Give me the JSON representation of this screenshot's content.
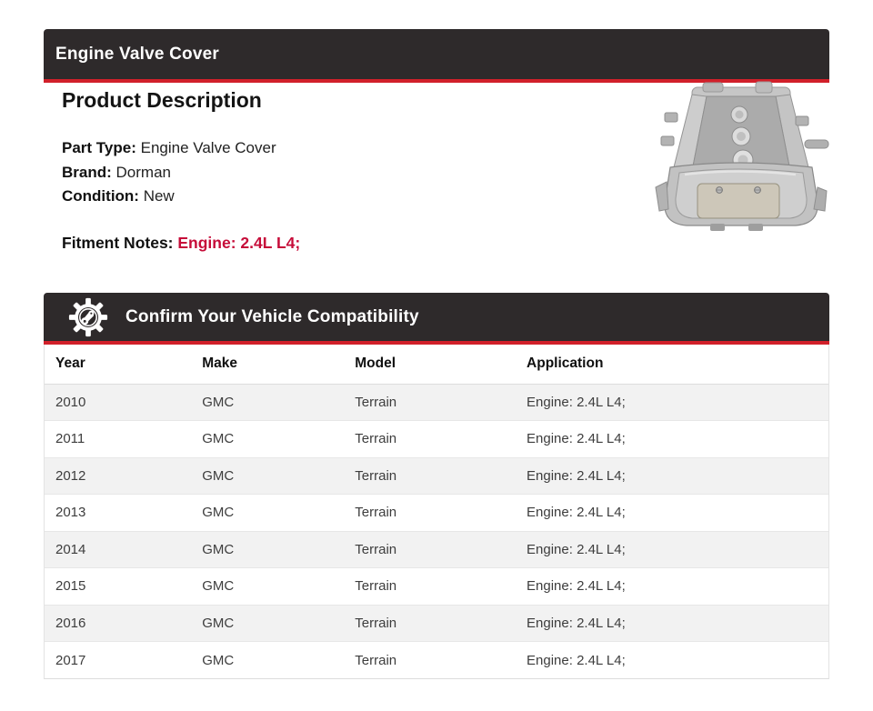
{
  "colors": {
    "bar_background": "#2e2a2b",
    "accent_red_line": "#d1202a",
    "fitment_red": "#c60c39",
    "row_alt": "#f2f2f2"
  },
  "header": {
    "title": "Engine Valve Cover"
  },
  "product": {
    "section_title": "Product Description",
    "fields": [
      {
        "label": "Part Type:",
        "value": "Engine Valve Cover"
      },
      {
        "label": "Brand:",
        "value": "Dorman"
      },
      {
        "label": "Condition:",
        "value": "New"
      }
    ],
    "fitment_label": "Fitment Notes:",
    "fitment_value": "Engine: 2.4L L4;"
  },
  "compatibility": {
    "icon": "gear-engine-icon",
    "title": "Confirm Your Vehicle Compatibility",
    "columns": [
      "Year",
      "Make",
      "Model",
      "Application"
    ],
    "rows": [
      [
        "2010",
        "GMC",
        "Terrain",
        "Engine: 2.4L L4;"
      ],
      [
        "2011",
        "GMC",
        "Terrain",
        "Engine: 2.4L L4;"
      ],
      [
        "2012",
        "GMC",
        "Terrain",
        "Engine: 2.4L L4;"
      ],
      [
        "2013",
        "GMC",
        "Terrain",
        "Engine: 2.4L L4;"
      ],
      [
        "2014",
        "GMC",
        "Terrain",
        "Engine: 2.4L L4;"
      ],
      [
        "2015",
        "GMC",
        "Terrain",
        "Engine: 2.4L L4;"
      ],
      [
        "2016",
        "GMC",
        "Terrain",
        "Engine: 2.4L L4;"
      ],
      [
        "2017",
        "GMC",
        "Terrain",
        "Engine: 2.4L L4;"
      ]
    ]
  }
}
